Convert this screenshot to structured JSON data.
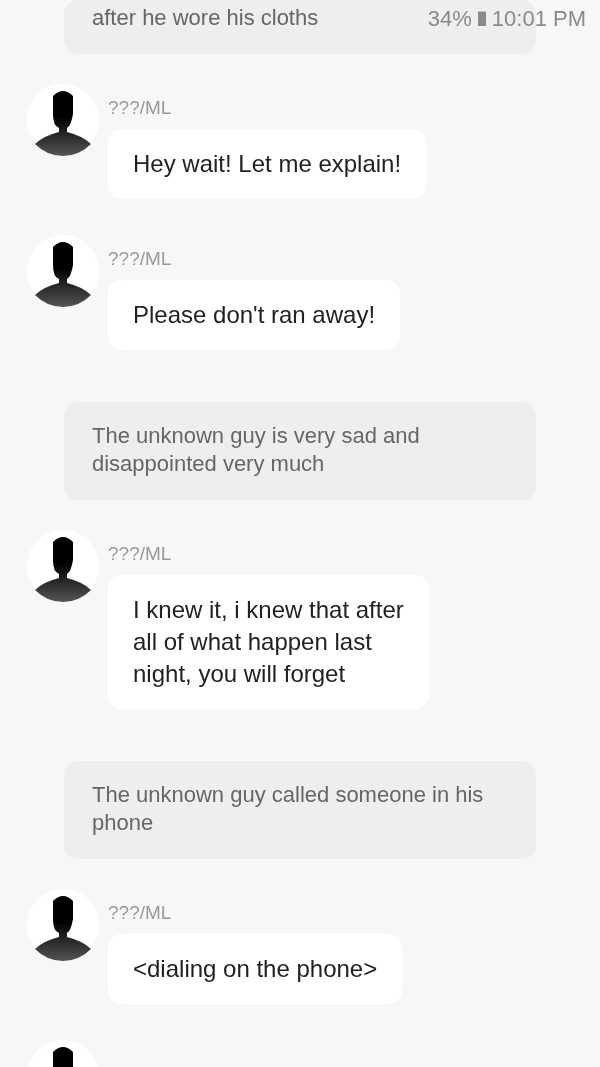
{
  "status_bar": {
    "battery": "34%",
    "time": "10:01 PM"
  },
  "items": [
    {
      "kind": "narration",
      "text": "after he wore his cloths"
    },
    {
      "kind": "chat",
      "sender": "???/ML",
      "text": "Hey wait! Let me explain!"
    },
    {
      "kind": "chat",
      "sender": "???/ML",
      "text": "Please don't ran away!"
    },
    {
      "kind": "narration",
      "text": "The unknown guy is very sad and\ndisappointed very much"
    },
    {
      "kind": "chat",
      "sender": "???/ML",
      "text": "I knew it, i knew that after\nall of what happen last\nnight, you will forget"
    },
    {
      "kind": "narration",
      "text": "The unknown guy called someone in his\nphone"
    },
    {
      "kind": "chat",
      "sender": "???/ML",
      "text": "<dialing on the phone>"
    },
    {
      "kind": "partial"
    }
  ]
}
